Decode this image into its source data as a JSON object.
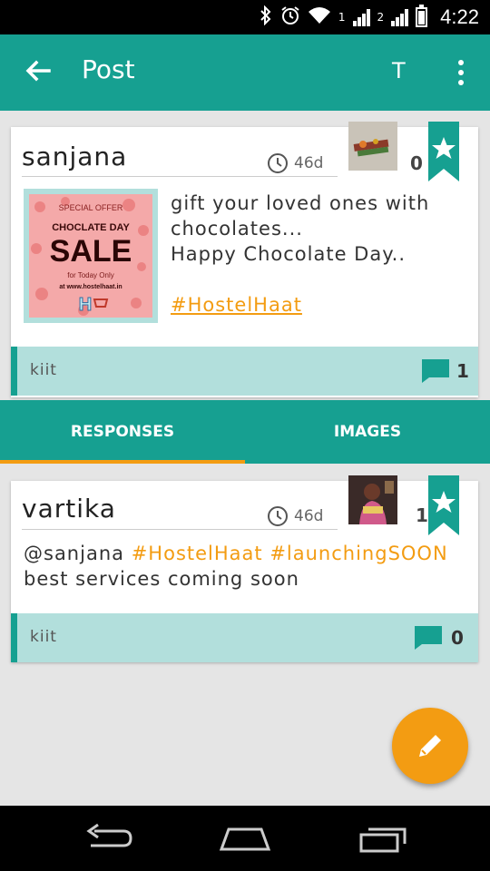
{
  "status_bar": {
    "time": "4:22",
    "sim1_label": "1",
    "sim2_label": "2",
    "icons": [
      "bluetooth-icon",
      "alarm-icon",
      "wifi-icon",
      "signal-icon",
      "battery-icon"
    ]
  },
  "app_bar": {
    "title": "Post",
    "t_button": "T",
    "back_icon": "arrow-back-icon",
    "more_icon": "more-vert-icon"
  },
  "post": {
    "username": "sanjana",
    "time": "46d",
    "likes": "0",
    "text_lines": [
      "gift your loved ones with",
      "chocolates...",
      "Happy Chocolate Day.."
    ],
    "hashtag": "#HostelHaat",
    "image": {
      "line1": "SPECIAL OFFER",
      "line2": "CHOCLATE DAY",
      "line3": "SALE",
      "line4": "for Today Only",
      "line5": "at www.hostelhaat.in",
      "line6": "H"
    },
    "footer_label": "kiit",
    "comment_count": "1"
  },
  "tabs": [
    {
      "label": "RESPONSES",
      "active": true
    },
    {
      "label": "IMAGES",
      "active": false
    }
  ],
  "response": {
    "username": "vartika",
    "time": "46d",
    "likes": "1",
    "mention": "@sanjana",
    "tag1": "#HostelHaat",
    "tag2": "#launchingSOON",
    "line2": "best services coming soon",
    "footer_label": "kiit",
    "comment_count": "0"
  },
  "colors": {
    "primary": "#16a091",
    "accent": "#f39c12",
    "footer_bg": "#b2dfdc"
  }
}
